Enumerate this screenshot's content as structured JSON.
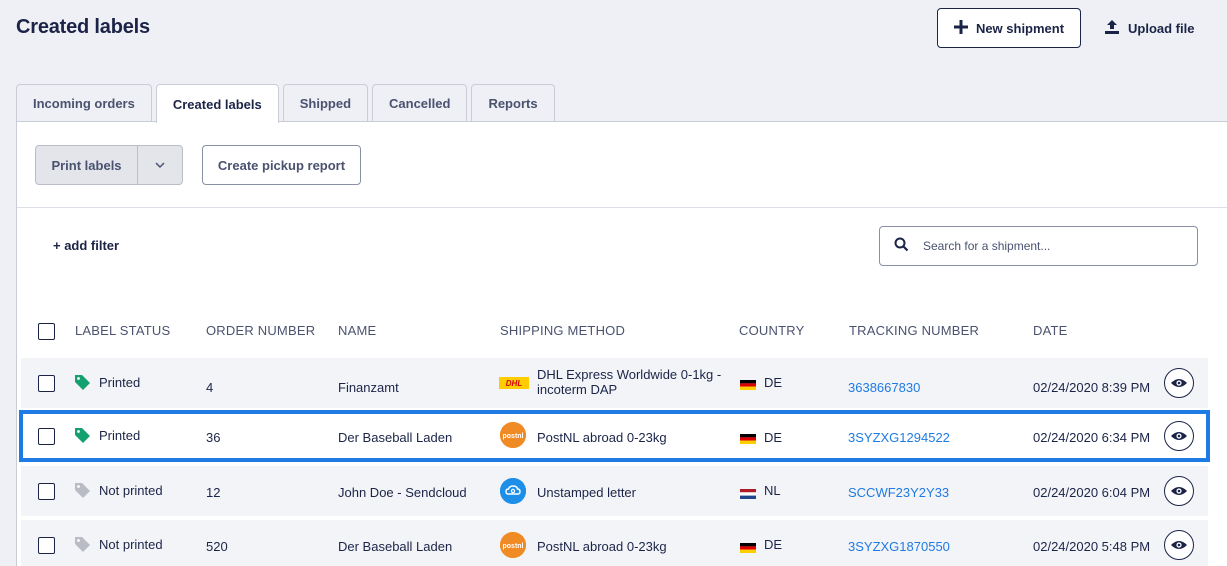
{
  "header": {
    "title": "Created labels",
    "new_shipment_label": "New shipment",
    "upload_file_label": "Upload file"
  },
  "tabs": [
    {
      "label": "Incoming orders",
      "active": false
    },
    {
      "label": "Created labels",
      "active": true
    },
    {
      "label": "Shipped",
      "active": false
    },
    {
      "label": "Cancelled",
      "active": false
    },
    {
      "label": "Reports",
      "active": false
    }
  ],
  "toolbar": {
    "print_labels_label": "Print labels",
    "pickup_report_label": "Create pickup report"
  },
  "filters": {
    "add_filter_label": "+ add filter",
    "search_placeholder": "Search for a shipment..."
  },
  "table": {
    "columns": {
      "label_status": "LABEL STATUS",
      "order_number": "ORDER NUMBER",
      "name": "NAME",
      "shipping_method": "SHIPPING METHOD",
      "country": "COUNTRY",
      "tracking_number": "TRACKING NUMBER",
      "date": "DATE"
    },
    "rows": [
      {
        "status": "Printed",
        "status_color": "#15a06f",
        "order": "4",
        "name": "Finanzamt",
        "method_line1": "DHL Express Worldwide 0-1kg -",
        "method_line2": "incoterm DAP",
        "carrier_icon": "dhl-icon",
        "country": "DE",
        "tracking": "3638667830",
        "date": "02/24/2020 8:39 PM"
      },
      {
        "status": "Printed",
        "status_color": "#15a06f",
        "order": "36",
        "name": "Der Baseball Laden",
        "method_line1": "PostNL abroad 0-23kg",
        "method_line2": "",
        "carrier_icon": "postnl-icon",
        "country": "DE",
        "tracking": "3SYZXG1294522",
        "date": "02/24/2020 6:34 PM",
        "highlighted": true
      },
      {
        "status": "Not printed",
        "status_color": "#b9bcc4",
        "order": "12",
        "name": "John Doe - Sendcloud",
        "method_line1": "Unstamped letter",
        "method_line2": "",
        "carrier_icon": "unstamped-icon",
        "country": "NL",
        "tracking": "SCCWF23Y2Y33",
        "date": "02/24/2020 6:04 PM"
      },
      {
        "status": "Not printed",
        "status_color": "#b9bcc4",
        "order": "520",
        "name": "Der Baseball Laden",
        "method_line1": "PostNL abroad 0-23kg",
        "method_line2": "",
        "carrier_icon": "postnl-icon",
        "country": "DE",
        "tracking": "3SYZXG1870550",
        "date": "02/24/2020 5:48 PM"
      }
    ]
  },
  "colors": {
    "accent": "#1e7be3",
    "primary_text": "#1b2447",
    "printed_tag": "#15a06f",
    "not_printed_tag": "#b9bcc4",
    "background": "#eef0f5"
  }
}
